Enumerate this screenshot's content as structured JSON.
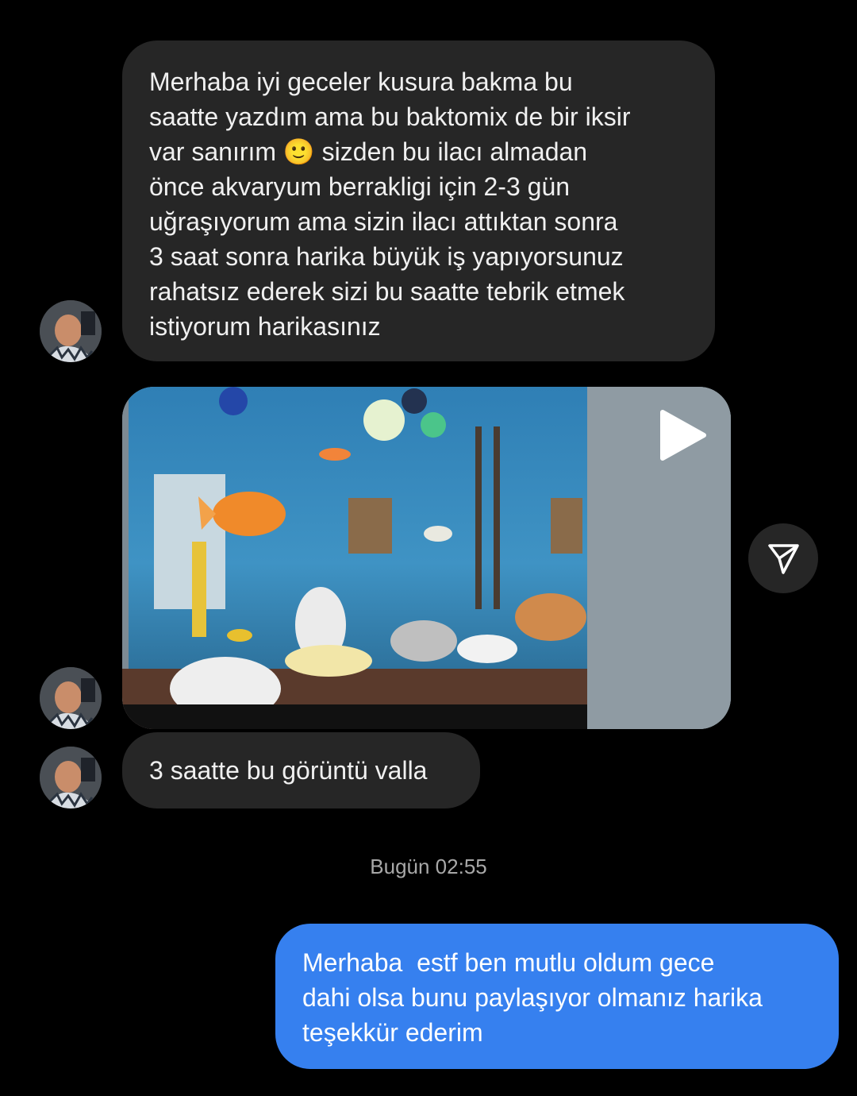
{
  "thread": {
    "messages": [
      {
        "sender": "them",
        "type": "text",
        "text": "Merhaba iyi geceler kusura bakma bu\nsaatte yazdım ama bu baktomix de bir iksir\nvar sanırım 🙂 sizden bu ilacı almadan\nönce akvaryum berrakligi için 2-3 gün\nuğraşıyorum ama sizin ilacı attıktan sonra\n3 saat sonra harika büyük iş yapıyorsunuz\nrahatsız ederek sizi bu saatte tebrik etmek\nistiyorum harikasınız"
      },
      {
        "sender": "them",
        "type": "video",
        "thumbnail_icon": "aquarium-video-thumbnail",
        "play_icon": "play-icon",
        "share_icon": "send-icon"
      },
      {
        "sender": "them",
        "type": "text",
        "text": "3 saatte bu görüntü valla"
      },
      {
        "sender": "me",
        "type": "text",
        "text": "Merhaba  estf ben mutlu oldum gece\ndahi olsa bunu paylaşıyor olmanız harika\nteşekkür ederim"
      }
    ],
    "timestamp": "Bugün 02:55"
  },
  "colors": {
    "background": "#000000",
    "incoming_bubble": "#262626",
    "outgoing_bubble": "#3680ef",
    "timestamp_text": "#a8a8a8"
  }
}
